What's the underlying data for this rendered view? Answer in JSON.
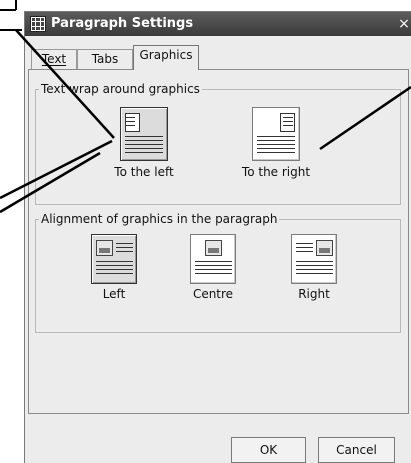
{
  "dialog": {
    "title": "Paragraph Settings",
    "close_glyph": "×",
    "tabs": [
      {
        "label": "Text"
      },
      {
        "label": "Tabs"
      },
      {
        "label": "Graphics",
        "selected": true
      }
    ],
    "wrap_group": {
      "title": "Text wrap around graphics",
      "options": [
        {
          "label": "To the left",
          "selected": true
        },
        {
          "label": "To the right",
          "selected": false
        }
      ]
    },
    "align_group": {
      "title": "Alignment of graphics in the paragraph",
      "options": [
        {
          "label": "Left",
          "selected": true
        },
        {
          "label": "Centre",
          "selected": false
        },
        {
          "label": "Right",
          "selected": false
        }
      ]
    },
    "buttons": {
      "ok": "OK",
      "cancel": "Cancel"
    }
  },
  "icons": [
    "app-grid-icon",
    "close-icon",
    "wrap-left-icon",
    "wrap-right-icon",
    "align-left-icon",
    "align-centre-icon",
    "align-right-icon"
  ],
  "colors": {
    "titlebar": "#444444",
    "dialog_bg": "#ececec",
    "callout": "#000000"
  }
}
